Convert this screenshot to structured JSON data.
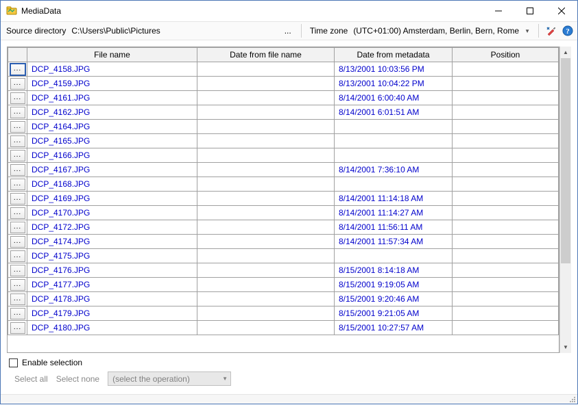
{
  "window": {
    "title": "MediaData"
  },
  "toolbar": {
    "source_label": "Source directory",
    "source_path": "C:\\Users\\Public\\Pictures",
    "ellipsis": "...",
    "timezone_label": "Time zone",
    "timezone_value": "(UTC+01:00) Amsterdam, Berlin, Bern, Rome"
  },
  "columns": {
    "btn": "",
    "filename": "File name",
    "date_from_filename": "Date from file name",
    "date_from_metadata": "Date from metadata",
    "position": "Position"
  },
  "rows": [
    {
      "btn": "...",
      "selected": true,
      "filename": "DCP_4158.JPG",
      "date_from_filename": "",
      "date_from_metadata": "8/13/2001 10:03:56 PM",
      "position": ""
    },
    {
      "btn": "...",
      "selected": false,
      "filename": "DCP_4159.JPG",
      "date_from_filename": "",
      "date_from_metadata": "8/13/2001 10:04:22 PM",
      "position": ""
    },
    {
      "btn": "...",
      "selected": false,
      "filename": "DCP_4161.JPG",
      "date_from_filename": "",
      "date_from_metadata": "8/14/2001 6:00:40 AM",
      "position": ""
    },
    {
      "btn": "...",
      "selected": false,
      "filename": "DCP_4162.JPG",
      "date_from_filename": "",
      "date_from_metadata": "8/14/2001 6:01:51 AM",
      "position": ""
    },
    {
      "btn": "...",
      "selected": false,
      "filename": "DCP_4164.JPG",
      "date_from_filename": "",
      "date_from_metadata": "",
      "position": ""
    },
    {
      "btn": "...",
      "selected": false,
      "filename": "DCP_4165.JPG",
      "date_from_filename": "",
      "date_from_metadata": "",
      "position": ""
    },
    {
      "btn": "...",
      "selected": false,
      "filename": "DCP_4166.JPG",
      "date_from_filename": "",
      "date_from_metadata": "",
      "position": ""
    },
    {
      "btn": "...",
      "selected": false,
      "filename": "DCP_4167.JPG",
      "date_from_filename": "",
      "date_from_metadata": "8/14/2001 7:36:10 AM",
      "position": ""
    },
    {
      "btn": "...",
      "selected": false,
      "filename": "DCP_4168.JPG",
      "date_from_filename": "",
      "date_from_metadata": "",
      "position": ""
    },
    {
      "btn": "...",
      "selected": false,
      "filename": "DCP_4169.JPG",
      "date_from_filename": "",
      "date_from_metadata": "8/14/2001 11:14:18 AM",
      "position": ""
    },
    {
      "btn": "...",
      "selected": false,
      "filename": "DCP_4170.JPG",
      "date_from_filename": "",
      "date_from_metadata": "8/14/2001 11:14:27 AM",
      "position": ""
    },
    {
      "btn": "...",
      "selected": false,
      "filename": "DCP_4172.JPG",
      "date_from_filename": "",
      "date_from_metadata": "8/14/2001 11:56:11 AM",
      "position": ""
    },
    {
      "btn": "...",
      "selected": false,
      "filename": "DCP_4174.JPG",
      "date_from_filename": "",
      "date_from_metadata": "8/14/2001 11:57:34 AM",
      "position": ""
    },
    {
      "btn": "...",
      "selected": false,
      "filename": "DCP_4175.JPG",
      "date_from_filename": "",
      "date_from_metadata": "",
      "position": ""
    },
    {
      "btn": "...",
      "selected": false,
      "filename": "DCP_4176.JPG",
      "date_from_filename": "",
      "date_from_metadata": "8/15/2001 8:14:18 AM",
      "position": ""
    },
    {
      "btn": "...",
      "selected": false,
      "filename": "DCP_4177.JPG",
      "date_from_filename": "",
      "date_from_metadata": "8/15/2001 9:19:05 AM",
      "position": ""
    },
    {
      "btn": "...",
      "selected": false,
      "filename": "DCP_4178.JPG",
      "date_from_filename": "",
      "date_from_metadata": "8/15/2001 9:20:46 AM",
      "position": ""
    },
    {
      "btn": "...",
      "selected": false,
      "filename": "DCP_4179.JPG",
      "date_from_filename": "",
      "date_from_metadata": "8/15/2001 9:21:05 AM",
      "position": ""
    },
    {
      "btn": "...",
      "selected": false,
      "filename": "DCP_4180.JPG",
      "date_from_filename": "",
      "date_from_metadata": "8/15/2001 10:27:57 AM",
      "position": ""
    }
  ],
  "bottom": {
    "enable_selection": "Enable selection",
    "select_all": "Select all",
    "select_none": "Select none",
    "operation_placeholder": "(select the operation)"
  }
}
